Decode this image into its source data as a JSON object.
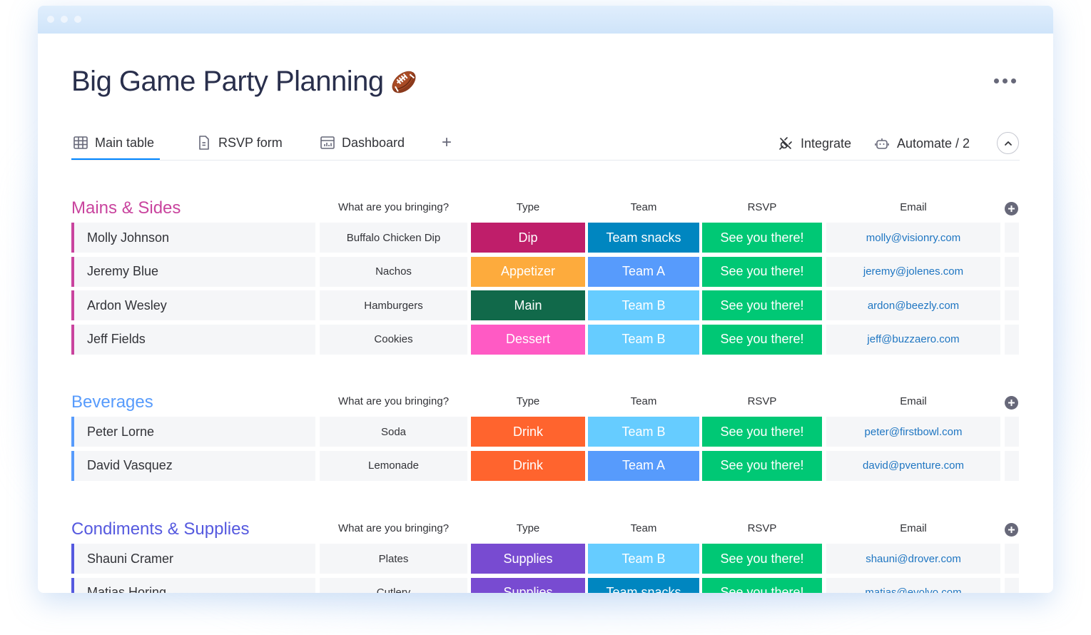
{
  "window": {
    "title_dots": 3
  },
  "board": {
    "title": "Big Game Party Planning",
    "title_emoji_icon": "american-football-icon",
    "more_icon": "more-horizontal-icon"
  },
  "tabs": {
    "items": [
      {
        "label": "Main table",
        "icon": "table-grid-icon",
        "active": true
      },
      {
        "label": "RSVP form",
        "icon": "form-doc-icon",
        "active": false
      },
      {
        "label": "Dashboard",
        "icon": "dashboard-chart-icon",
        "active": false
      }
    ],
    "add_icon": "plus-icon",
    "integrate_label": "Integrate",
    "integrate_icon": "plug-icon",
    "automate_label": "Automate / 2",
    "automate_icon": "robot-icon",
    "collapse_icon": "chevron-up-icon"
  },
  "columns": {
    "bring": "What are you bringing?",
    "type": "Type",
    "team": "Team",
    "rsvp": "RSVP",
    "email": "Email"
  },
  "colors": {
    "group_mains": "#c9449e",
    "group_beverages": "#579bfc",
    "group_condiments": "#5559df",
    "rsvp_green": "#00c875",
    "email_link": "#1f76c2",
    "tab_active": "#0085ff",
    "type_dip": "#bf1e6a",
    "type_appetizer": "#fdab3d",
    "type_main": "#11694a",
    "type_dessert": "#ff5ac4",
    "type_drink": "#ff642e",
    "type_supplies": "#784bd1",
    "team_snacks": "#0086c0",
    "team_a": "#579bfc",
    "team_b": "#66ccff"
  },
  "groups": [
    {
      "title": "Mains & Sides",
      "rows": [
        {
          "name": "Molly Johnson",
          "bring": "Buffalo Chicken Dip",
          "type": "Dip",
          "team": "Team snacks",
          "rsvp": "See you there!",
          "email": "molly@visionry.com"
        },
        {
          "name": "Jeremy Blue",
          "bring": "Nachos",
          "type": "Appetizer",
          "team": "Team A",
          "rsvp": "See you there!",
          "email": "jeremy@jolenes.com"
        },
        {
          "name": "Ardon Wesley",
          "bring": "Hamburgers",
          "type": "Main",
          "team": "Team B",
          "rsvp": "See you there!",
          "email": "ardon@beezly.com"
        },
        {
          "name": "Jeff Fields",
          "bring": "Cookies",
          "type": "Dessert",
          "team": "Team B",
          "rsvp": "See you there!",
          "email": "jeff@buzzaero.com"
        }
      ]
    },
    {
      "title": "Beverages",
      "rows": [
        {
          "name": "Peter Lorne",
          "bring": "Soda",
          "type": "Drink",
          "team": "Team B",
          "rsvp": "See you there!",
          "email": "peter@firstbowl.com"
        },
        {
          "name": "David Vasquez",
          "bring": "Lemonade",
          "type": "Drink",
          "team": "Team A",
          "rsvp": "See you there!",
          "email": "david@pventure.com"
        }
      ]
    },
    {
      "title": "Condiments & Supplies",
      "rows": [
        {
          "name": "Shauni Cramer",
          "bring": "Plates",
          "type": "Supplies",
          "team": "Team B",
          "rsvp": "See you there!",
          "email": "shauni@drover.com"
        },
        {
          "name": "Matias Horing",
          "bring": "Cutlery",
          "type": "Supplies",
          "team": "Team snacks",
          "rsvp": "See you there!",
          "email": "matias@evolvo.com"
        }
      ]
    }
  ]
}
